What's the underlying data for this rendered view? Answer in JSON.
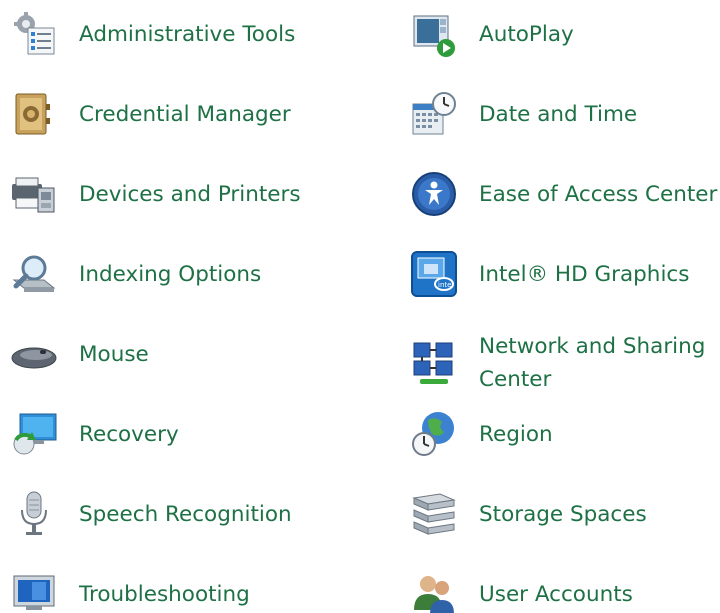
{
  "control_panel": {
    "items": [
      {
        "label": "Administrative Tools",
        "icon": "administrative-tools-icon"
      },
      {
        "label": "AutoPlay",
        "icon": "autoplay-icon"
      },
      {
        "label": "Credential Manager",
        "icon": "credential-manager-icon"
      },
      {
        "label": "Date and Time",
        "icon": "date-and-time-icon"
      },
      {
        "label": "Devices and Printers",
        "icon": "devices-and-printers-icon"
      },
      {
        "label": "Ease of Access Center",
        "icon": "ease-of-access-icon"
      },
      {
        "label": "Indexing Options",
        "icon": "indexing-options-icon"
      },
      {
        "label": "Intel® HD Graphics",
        "icon": "intel-hd-graphics-icon"
      },
      {
        "label": "Mouse",
        "icon": "mouse-icon"
      },
      {
        "label": "Network and Sharing Center",
        "icon": "network-and-sharing-icon"
      },
      {
        "label": "Recovery",
        "icon": "recovery-icon"
      },
      {
        "label": "Region",
        "icon": "region-icon"
      },
      {
        "label": "Speech Recognition",
        "icon": "speech-recognition-icon"
      },
      {
        "label": "Storage Spaces",
        "icon": "storage-spaces-icon"
      },
      {
        "label": "Troubleshooting",
        "icon": "troubleshooting-icon"
      },
      {
        "label": "User Accounts",
        "icon": "user-accounts-icon"
      }
    ]
  },
  "colors": {
    "link_text": "#1e7145",
    "background": "#ffffff"
  }
}
